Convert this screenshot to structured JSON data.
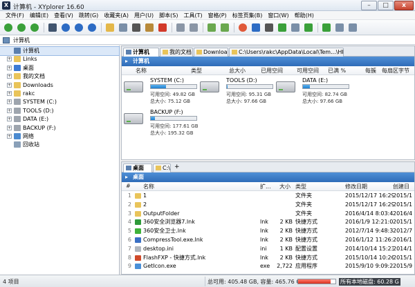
{
  "window": {
    "title": "计算机 - XYplorer 16.60",
    "close_glyph": "x",
    "min_glyph": "–",
    "max_glyph": "□"
  },
  "menu": [
    "文件(F)",
    "编辑(E)",
    "查看(V)",
    "跳转(G)",
    "收藏夹(A)",
    "用户(U)",
    "脚本(S)",
    "工具(T)",
    "窗格(P)",
    "标签页集(B)",
    "窗口(W)",
    "帮助(H)"
  ],
  "address": {
    "value": "计算机"
  },
  "tree": [
    {
      "label": "计算机",
      "expander": "",
      "selected": true,
      "icon": "computer-icon",
      "color": "#5a7fae"
    },
    {
      "label": "Links",
      "expander": "+",
      "icon": "folder-icon",
      "color": "#e9c45a"
    },
    {
      "label": "桌面",
      "expander": "+",
      "icon": "desktop-icon",
      "color": "#3d7bd4"
    },
    {
      "label": "我的文档",
      "expander": "+",
      "icon": "documents-icon",
      "color": "#e9c45a"
    },
    {
      "label": "Downloads",
      "expander": "+",
      "icon": "downloads-icon",
      "color": "#e9c45a"
    },
    {
      "label": "rakc",
      "expander": "+",
      "icon": "user-folder-icon",
      "color": "#e9c45a"
    },
    {
      "label": "SYSTEM (C:)",
      "expander": "+",
      "icon": "drive-icon",
      "color": "#9ea5ae"
    },
    {
      "label": "TOOLS (D:)",
      "expander": "+",
      "icon": "drive-icon",
      "color": "#9ea5ae"
    },
    {
      "label": "DATA (E:)",
      "expander": "+",
      "icon": "drive-icon",
      "color": "#9ea5ae"
    },
    {
      "label": "BACKUP (F:)",
      "expander": "+",
      "icon": "drive-icon",
      "color": "#9ea5ae"
    },
    {
      "label": "网络",
      "expander": "+",
      "icon": "network-icon",
      "color": "#4a8ad0"
    },
    {
      "label": "回收站",
      "expander": "",
      "icon": "recycle-bin-icon",
      "color": "#8aa0b8"
    }
  ],
  "pane1": {
    "tabs": [
      {
        "label": "计算机",
        "active": true
      },
      {
        "label": "我的文档"
      },
      {
        "label": "Downloads"
      },
      {
        "label": "C:\\Users\\rakc\\AppData\\Local\\Tem...\\HP"
      }
    ],
    "path": "计算机",
    "headers": [
      "名称",
      "类型",
      "总大小",
      "已用空间",
      "可用空间",
      "已满 %",
      "每簇",
      "每扇区字节"
    ],
    "drives": [
      {
        "name": "SYSTEM (C:)",
        "free": "可用空间: 49.82 GB",
        "total": "总大小: 75.12 GB",
        "used_fraction": 0.34
      },
      {
        "name": "TOOLS (D:)",
        "free": "可用空间: 95.31 GB",
        "total": "总大小: 97.66 GB",
        "used_fraction": 0.02
      },
      {
        "name": "DATA (E:)",
        "free": "可用空间: 82.74 GB",
        "total": "总大小: 97.66 GB",
        "used_fraction": 0.15
      },
      {
        "name": "BACKUP (F:)",
        "free": "可用空间: 177.61 GB",
        "total": "总大小: 195.32 GB",
        "used_fraction": 0.09
      }
    ]
  },
  "pane2": {
    "tabs": [
      {
        "label": "桌面",
        "active": true
      },
      {
        "label": "C:\\"
      }
    ],
    "tab_add": "+",
    "path": "桌面",
    "headers": [
      "#",
      "名称",
      "扩...",
      "大小",
      "类型",
      "修改日期",
      "创建日"
    ],
    "files": [
      {
        "n": "1",
        "name": "1",
        "ext": "",
        "size": "",
        "type": "文件夹",
        "modified": "2015/12/17 16:29:...",
        "created": "2015/1",
        "icon": "folder-icon",
        "color": "#e9c45a"
      },
      {
        "n": "2",
        "name": "2",
        "ext": "",
        "size": "",
        "type": "文件夹",
        "modified": "2015/12/17 16:29:...",
        "created": "2015/1",
        "icon": "folder-icon",
        "color": "#e9c45a"
      },
      {
        "n": "3",
        "name": "OutputFolder",
        "ext": "",
        "size": "",
        "type": "文件夹",
        "modified": "2016/4/14 8:03:48",
        "created": "2016/4",
        "icon": "folder-icon",
        "color": "#e9c45a"
      },
      {
        "n": "4",
        "name": "360安全浏览器7.lnk",
        "ext": "lnk",
        "size": "2 KB",
        "type": "快捷方式",
        "modified": "2016/1/9 12:21:00",
        "created": "2015/1",
        "icon": "browser-icon",
        "color": "#2f9a3a"
      },
      {
        "n": "5",
        "name": "360安全卫士.lnk",
        "ext": "lnk",
        "size": "2 KB",
        "type": "快捷方式",
        "modified": "2012/7/14 9:48:34",
        "created": "2012/7",
        "icon": "shield-icon",
        "color": "#3fb23a"
      },
      {
        "n": "6",
        "name": "CompressTool.exe.lnk",
        "ext": "lnk",
        "size": "2 KB",
        "type": "快捷方式",
        "modified": "2016/1/12 11:26:37",
        "created": "2016/1",
        "icon": "app-icon",
        "color": "#3a6fc4"
      },
      {
        "n": "7",
        "name": "desktop.ini",
        "ext": "ini",
        "size": "1 KB",
        "type": "配置设置",
        "modified": "2014/10/14 15:23:...",
        "created": "2014/1",
        "icon": "settings-file-icon",
        "color": "#b0b6be"
      },
      {
        "n": "8",
        "name": "FlashFXP - 快捷方式.lnk",
        "ext": "lnk",
        "size": "2 KB",
        "type": "快捷方式",
        "modified": "2015/10/14 10:26:...",
        "created": "2015/1",
        "icon": "ftp-icon",
        "color": "#d04a2a"
      },
      {
        "n": "9",
        "name": "GetIcon.exe",
        "ext": "exe",
        "size": "2,722 ...",
        "type": "应用程序",
        "modified": "2015/9/10 9:09:22",
        "created": "2015/9",
        "icon": "app-icon",
        "color": "#4a90d8"
      }
    ]
  },
  "status": {
    "items": "4 项目",
    "space": "总可用: 405.48 GB, 容量: 465.76 GB",
    "disk_label": "所有本地磁盘: 60.28 G",
    "disk_fraction": 0.87
  }
}
